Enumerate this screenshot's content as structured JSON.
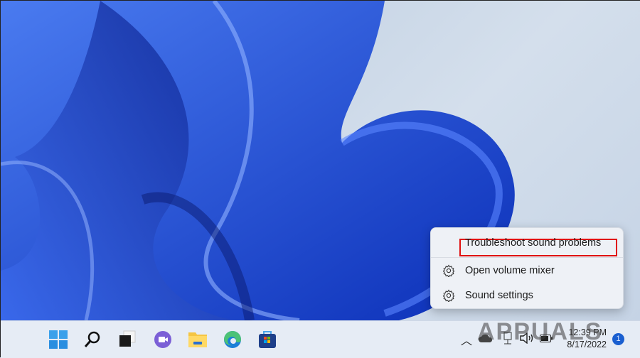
{
  "context_menu": {
    "items": [
      {
        "label": "Troubleshoot sound problems",
        "icon": null,
        "highlighted": true
      },
      {
        "label": "Open volume mixer",
        "icon": "gear-icon"
      },
      {
        "label": "Sound settings",
        "icon": "gear-icon"
      }
    ]
  },
  "taskbar": {
    "apps": [
      "start-icon",
      "search-icon",
      "task-view-icon",
      "teams-chat-icon",
      "file-explorer-icon",
      "edge-icon",
      "store-icon"
    ],
    "tray": {
      "time": "12:39 PM",
      "date": "8/17/2022",
      "notification_count": "1"
    }
  },
  "watermark": "APPUALS",
  "colors": {
    "highlight_box": "#e01010",
    "accent": "#1a5fd0"
  }
}
